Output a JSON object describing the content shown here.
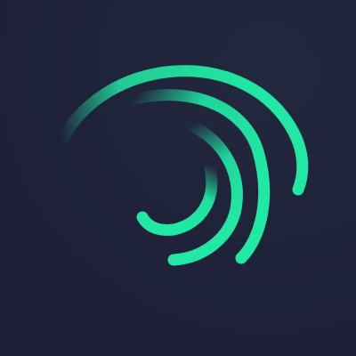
{
  "icon": {
    "name": "swirl-logo-icon",
    "background_color": "#1e2037",
    "accent_color": "#21e8a4",
    "arc_count": 4
  }
}
